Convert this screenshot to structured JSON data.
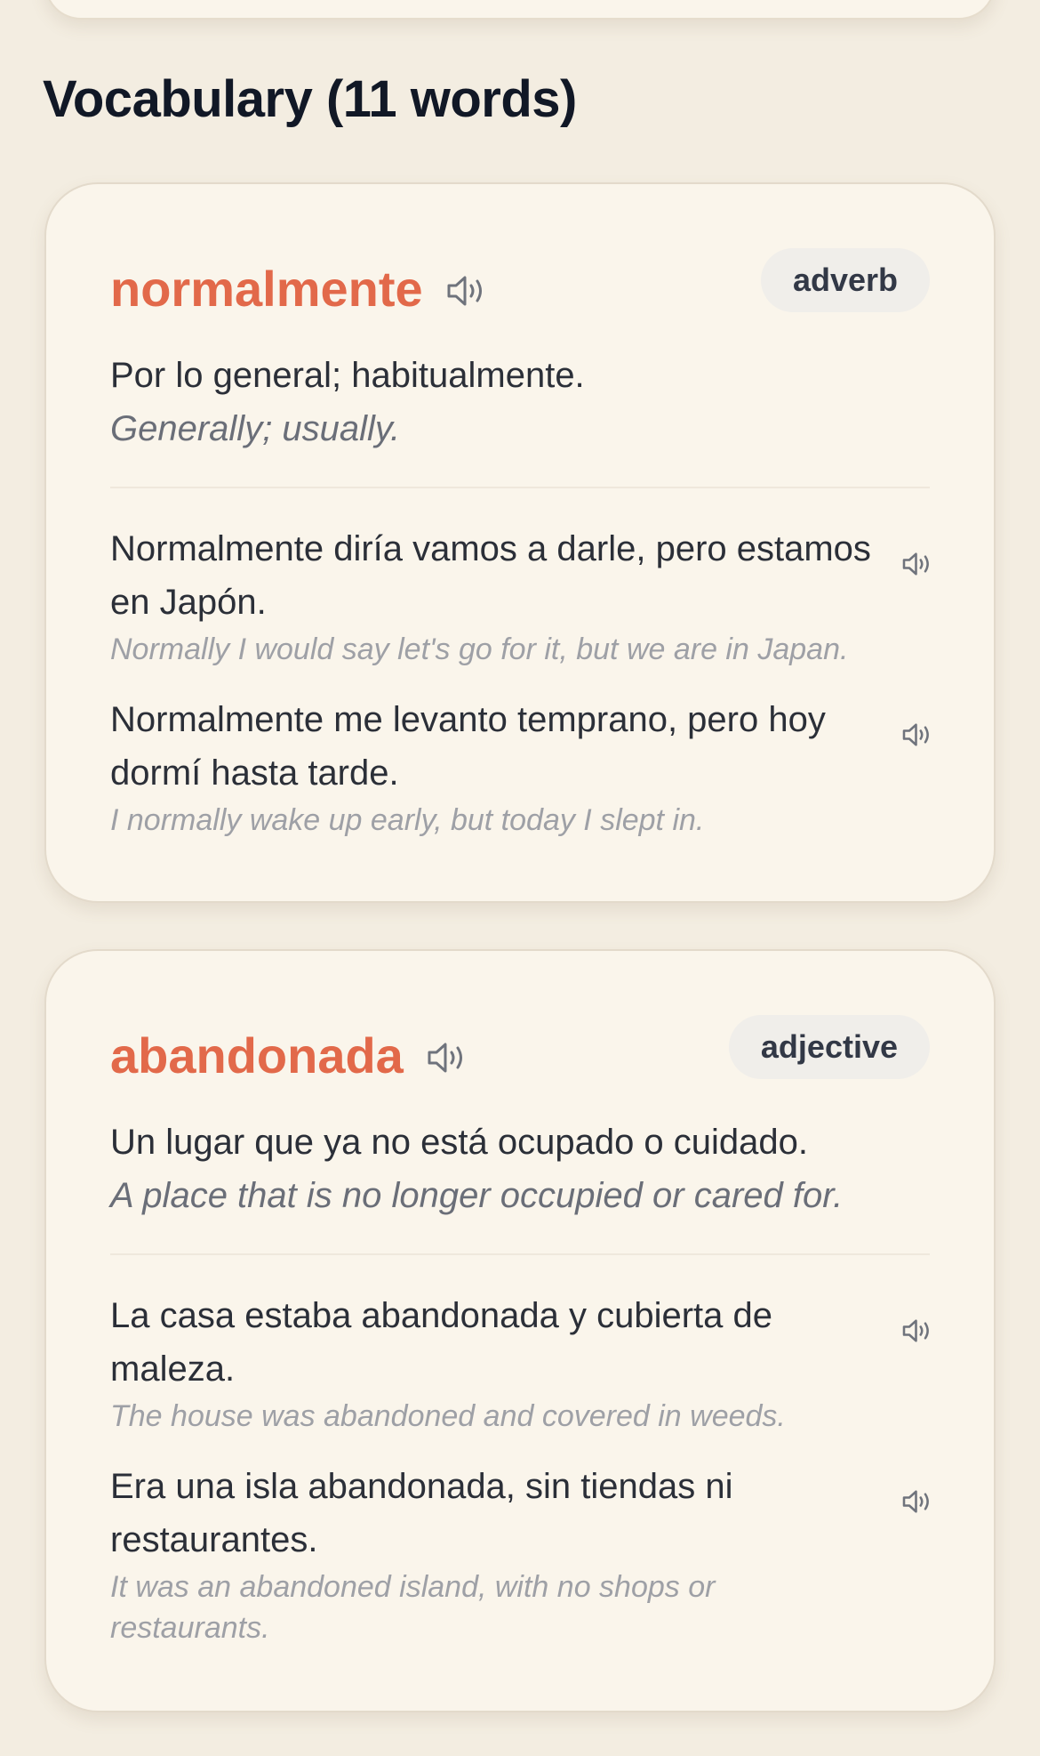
{
  "section": {
    "title": "Vocabulary (11 words)"
  },
  "vocabulary": [
    {
      "word": "normalmente",
      "part_of_speech": "adverb",
      "definition": "Por lo general; habitualmente.",
      "definition_translation": "Generally; usually.",
      "examples": [
        {
          "spanish": "Normalmente diría vamos a darle, pero estamos en Japón.",
          "english": "Normally I would say let's go for it, but we are in Japan."
        },
        {
          "spanish": "Normalmente me levanto temprano, pero hoy dormí hasta tarde.",
          "english": "I normally wake up early, but today I slept in."
        }
      ]
    },
    {
      "word": "abandonada",
      "part_of_speech": "adjective",
      "definition": "Un lugar que ya no está ocupado o cuidado.",
      "definition_translation": "A place that is no longer occupied or cared for.",
      "examples": [
        {
          "spanish": "La casa estaba abandonada y cubierta de maleza.",
          "english": "The house was abandoned and covered in weeds."
        },
        {
          "spanish": "Era una isla abandonada, sin tiendas ni restaurantes.",
          "english": "It was an abandoned island, with no shops or restaurants."
        }
      ]
    }
  ],
  "icons": {
    "speaker": "speaker-icon"
  },
  "colors": {
    "accent": "#e2694a",
    "background": "#f3ede1",
    "card": "#faf5eb",
    "badge": "#f0eeea"
  }
}
